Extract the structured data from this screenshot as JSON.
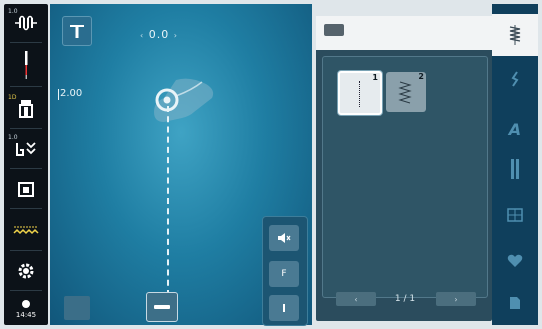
{
  "left_rail": {
    "items": [
      {
        "label": "1.0",
        "icon": "upper-thread-tension-icon"
      },
      {
        "label": "",
        "icon": "needle-icon"
      },
      {
        "label": "1D",
        "icon": "presser-foot-icon"
      },
      {
        "label": "1.0",
        "icon": "presser-foot-pressure-icon"
      },
      {
        "label": "",
        "icon": "stitch-plate-icon"
      },
      {
        "label": "",
        "icon": "bobbin-stitch-icon"
      },
      {
        "label": "",
        "icon": "settings-icon"
      }
    ],
    "time": "14:45"
  },
  "stitch_area": {
    "offset_value": "0.0",
    "stitch_length": "2.00"
  },
  "right_panel": {
    "stitches": [
      {
        "number": "1"
      },
      {
        "number": "2"
      }
    ],
    "page": "1 / 1"
  },
  "side_controls": {
    "mute_icon": "speaker-mute-icon",
    "btn_f": "F"
  },
  "colors": {
    "accent": "#2b90b8",
    "panel": "#2b4c5d"
  }
}
